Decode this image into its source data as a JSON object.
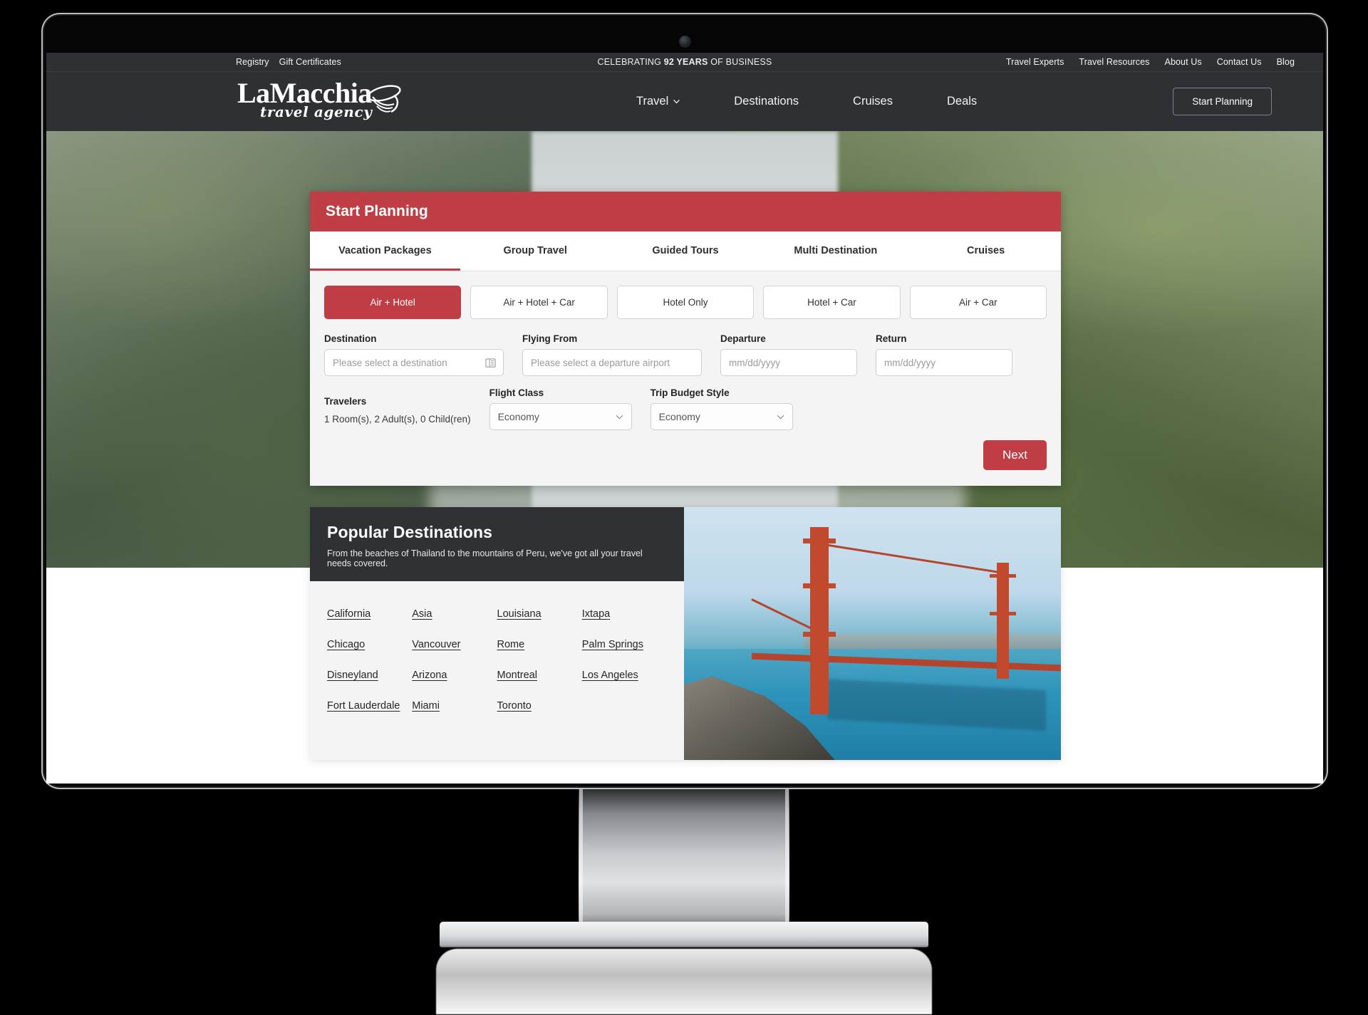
{
  "topbar": {
    "left_links": [
      "Registry",
      "Gift Certificates"
    ],
    "center_prefix": "CELEBRATING ",
    "center_bold": "92 YEARS",
    "center_suffix": " OF BUSINESS",
    "right_links": [
      "Travel Experts",
      "Travel Resources",
      "About Us",
      "Contact Us",
      "Blog"
    ]
  },
  "header": {
    "logo_name": "LaMacchia",
    "logo_tagline": "travel agency",
    "nav": [
      {
        "label": "Travel",
        "has_chevron": true
      },
      {
        "label": "Destinations",
        "has_chevron": false
      },
      {
        "label": "Cruises",
        "has_chevron": false
      },
      {
        "label": "Deals",
        "has_chevron": false
      }
    ],
    "cta_label": "Start Planning"
  },
  "booking": {
    "panel_title": "Start Planning",
    "accent_color": "#bf3d45",
    "tabs": [
      {
        "label": "Vacation Packages",
        "active": true
      },
      {
        "label": "Group Travel",
        "active": false
      },
      {
        "label": "Guided Tours",
        "active": false
      },
      {
        "label": "Multi Destination",
        "active": false
      },
      {
        "label": "Cruises",
        "active": false
      }
    ],
    "package_types": [
      {
        "label": "Air + Hotel",
        "selected": true
      },
      {
        "label": "Air + Hotel + Car",
        "selected": false
      },
      {
        "label": "Hotel Only",
        "selected": false
      },
      {
        "label": "Hotel + Car",
        "selected": false
      },
      {
        "label": "Air + Car",
        "selected": false
      }
    ],
    "fields": {
      "destination_label": "Destination",
      "destination_placeholder": "Please select a destination",
      "destination_icon": "list-select-icon",
      "flying_from_label": "Flying From",
      "flying_from_placeholder": "Please select a departure airport",
      "departure_label": "Departure",
      "departure_placeholder": "mm/dd/yyyy",
      "return_label": "Return",
      "return_placeholder": "mm/dd/yyyy"
    },
    "travelers_label": "Travelers",
    "travelers_value": "1 Room(s), 2 Adult(s), 0 Child(ren)",
    "flight_class_label": "Flight Class",
    "flight_class_value": "Economy",
    "trip_budget_label": "Trip Budget Style",
    "trip_budget_value": "Economy",
    "next_label": "Next"
  },
  "popular": {
    "title": "Popular Destinations",
    "subtitle": "From the beaches of Thailand to the mountains of Peru, we've got all your travel needs covered.",
    "links": [
      "California",
      "Asia",
      "Louisiana",
      "Ixtapa",
      "Chicago",
      "Vancouver",
      "Rome",
      "Palm Springs",
      "Disneyland",
      "Arizona",
      "Montreal",
      "Los Angeles",
      "Fort Lauderdale",
      "Miami",
      "Toronto"
    ]
  }
}
